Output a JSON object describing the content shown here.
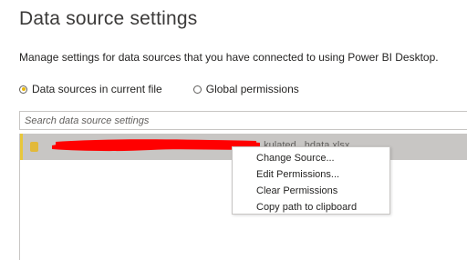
{
  "header": {
    "title": "Data source settings",
    "subtitle": "Manage settings for data sources that you have connected to using Power BI Desktop."
  },
  "scope": {
    "options": [
      {
        "label": "Data sources in current file",
        "selected": true
      },
      {
        "label": "Global permissions",
        "selected": false
      }
    ]
  },
  "search": {
    "placeholder": "Search data source settings",
    "value": ""
  },
  "data_sources": [
    {
      "label": "...kulated...hdata.xlsx",
      "redacted": true,
      "icon": "file-icon",
      "selected": true
    }
  ],
  "context_menu": {
    "items": [
      {
        "label": "Change Source..."
      },
      {
        "label": "Edit Permissions..."
      },
      {
        "label": "Clear Permissions"
      },
      {
        "label": "Copy path to clipboard"
      }
    ]
  },
  "colors": {
    "accent": "#e8b70a",
    "selected_row": "#c8c6c4",
    "redaction": "#ff0000"
  }
}
